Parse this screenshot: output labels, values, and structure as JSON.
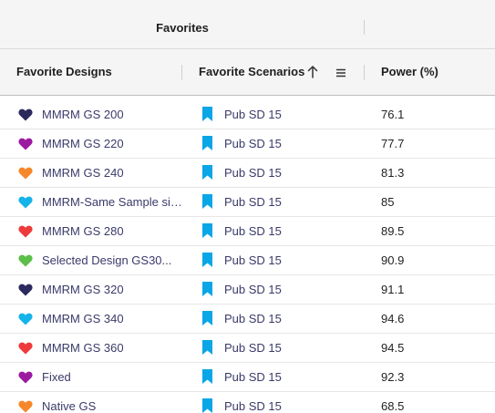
{
  "group_header": {
    "title": "Favorites"
  },
  "columns": {
    "designs": "Favorite Designs",
    "scenarios": "Favorite Scenarios",
    "power": "Power (%)"
  },
  "icons": {
    "sort": "arrow-up-icon",
    "menu": "menu-icon",
    "design": "heart-icon",
    "scenario": "bookmark-icon"
  },
  "bookmark_color": "#0aa6e6",
  "rows": [
    {
      "design": "MMRM GS 200",
      "heart_color": "#2b2a5c",
      "scenario": "Pub SD 15",
      "power": "76.1"
    },
    {
      "design": "MMRM GS 220",
      "heart_color": "#9c1aa0",
      "scenario": "Pub SD 15",
      "power": "77.7"
    },
    {
      "design": "MMRM GS 240",
      "heart_color": "#f5882a",
      "scenario": "Pub SD 15",
      "power": "81.3"
    },
    {
      "design": "MMRM-Same Sample size",
      "heart_color": "#14b4ea",
      "scenario": "Pub SD 15",
      "power": "85"
    },
    {
      "design": "MMRM GS 280",
      "heart_color": "#ee3a3a",
      "scenario": "Pub SD 15",
      "power": "89.5"
    },
    {
      "design": "Selected Design GS30...",
      "heart_color": "#5cbf4a",
      "scenario": "Pub SD 15",
      "power": "90.9"
    },
    {
      "design": "MMRM GS 320",
      "heart_color": "#2b2a5c",
      "scenario": "Pub SD 15",
      "power": "91.1"
    },
    {
      "design": "MMRM GS 340",
      "heart_color": "#14b4ea",
      "scenario": "Pub SD 15",
      "power": "94.6"
    },
    {
      "design": "MMRM GS 360",
      "heart_color": "#ee3a3a",
      "scenario": "Pub SD 15",
      "power": "94.5"
    },
    {
      "design": "Fixed",
      "heart_color": "#9c1aa0",
      "scenario": "Pub SD 15",
      "power": "92.3"
    },
    {
      "design": "Native GS",
      "heart_color": "#f5882a",
      "scenario": "Pub SD 15",
      "power": "68.5"
    }
  ]
}
